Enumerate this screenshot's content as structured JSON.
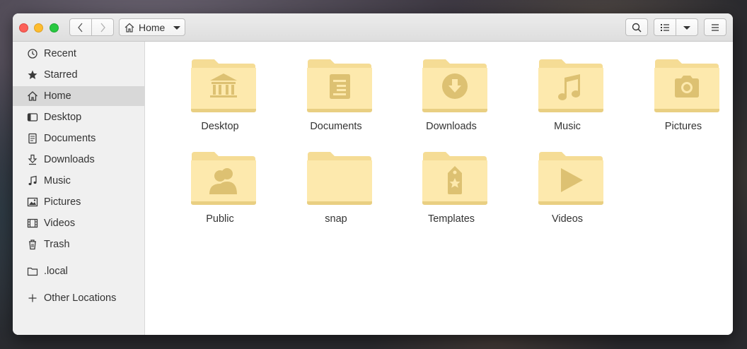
{
  "window": {
    "path_label": "Home"
  },
  "sidebar": {
    "items": [
      {
        "label": "Recent",
        "icon": "clock-icon"
      },
      {
        "label": "Starred",
        "icon": "star-icon"
      },
      {
        "label": "Home",
        "icon": "home-icon",
        "active": true
      },
      {
        "label": "Desktop",
        "icon": "desktop-icon"
      },
      {
        "label": "Documents",
        "icon": "document-icon"
      },
      {
        "label": "Downloads",
        "icon": "download-icon"
      },
      {
        "label": "Music",
        "icon": "music-icon"
      },
      {
        "label": "Pictures",
        "icon": "picture-icon"
      },
      {
        "label": "Videos",
        "icon": "video-icon"
      },
      {
        "label": "Trash",
        "icon": "trash-icon"
      },
      {
        "label": ".local",
        "icon": "folder-icon"
      },
      {
        "label": "Other Locations",
        "icon": "plus-icon"
      }
    ]
  },
  "files": [
    {
      "name": "Desktop",
      "emblem": "bank-icon"
    },
    {
      "name": "Documents",
      "emblem": "document-icon"
    },
    {
      "name": "Downloads",
      "emblem": "download-icon"
    },
    {
      "name": "Music",
      "emblem": "music-note-icon"
    },
    {
      "name": "Pictures",
      "emblem": "camera-icon"
    },
    {
      "name": "Public",
      "emblem": "users-icon"
    },
    {
      "name": "snap",
      "emblem": ""
    },
    {
      "name": "Templates",
      "emblem": "tag-star-icon"
    },
    {
      "name": "Videos",
      "emblem": "play-icon"
    }
  ],
  "colors": {
    "folder_light": "#fde9ad",
    "folder_body": "#fbe19a",
    "folder_emblem": "#d9bd6e",
    "sidebar_active": "#d8d8d8"
  }
}
